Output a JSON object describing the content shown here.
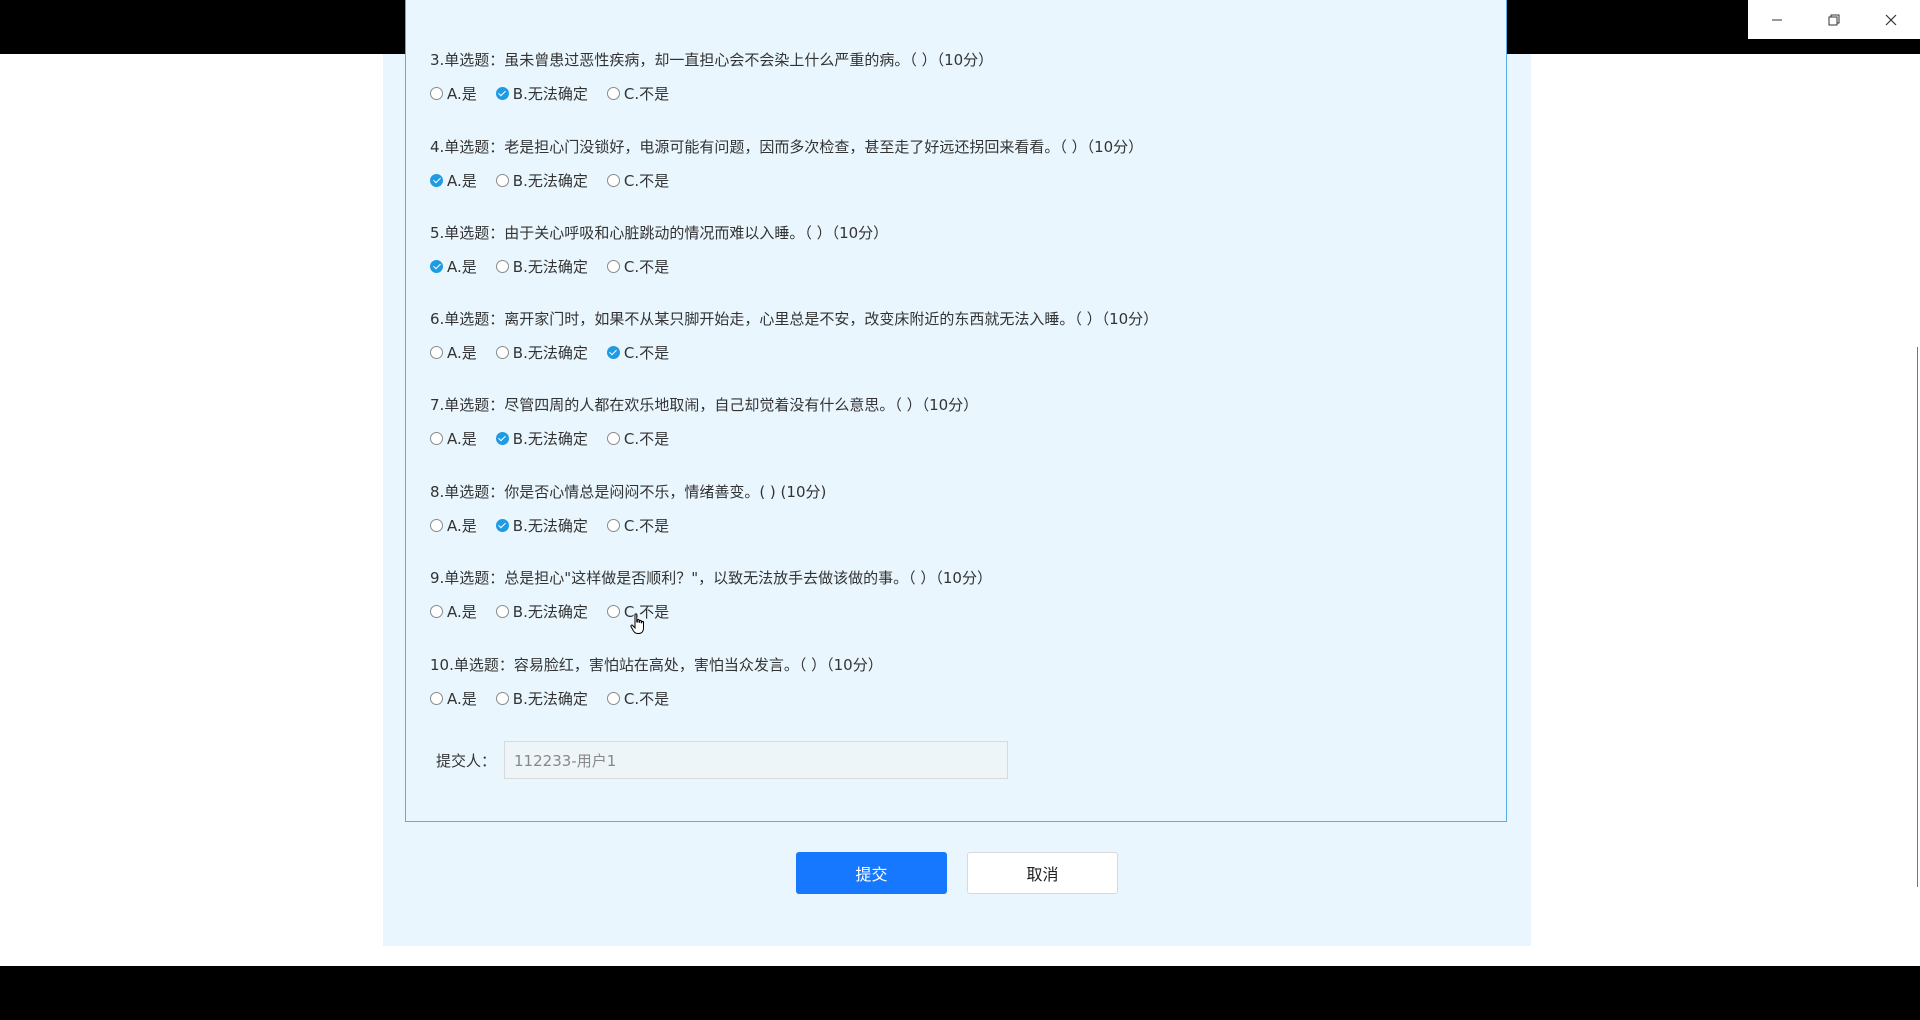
{
  "window_controls": {
    "minimize": "minimize-icon",
    "restore": "restore-icon",
    "close": "close-icon"
  },
  "questions": [
    {
      "text": "3.单选题：虽未曾患过恶性疾病，却一直担心会不会染上什么严重的病。（ ）（10分）",
      "selected": 1
    },
    {
      "text": "4.单选题：老是担心门没锁好，电源可能有问题，因而多次检查，甚至走了好远还拐回来看看。（ ）（10分）",
      "selected": 0
    },
    {
      "text": "5.单选题：由于关心呼吸和心脏跳动的情况而难以入睡。（ ）（10分）",
      "selected": 0
    },
    {
      "text": "6.单选题：离开家门时，如果不从某只脚开始走，心里总是不安，改变床附近的东西就无法入睡。（ ）（10分）",
      "selected": 2
    },
    {
      "text": "7.单选题：尽管四周的人都在欢乐地取闹，自己却觉着没有什么意思。（ ）（10分）",
      "selected": 1
    },
    {
      "text": "8.单选题：你是否心情总是闷闷不乐，情绪善变。( ) (10分)",
      "selected": 1
    },
    {
      "text": "9.单选题：总是担心\"这样做是否顺利？\"，以致无法放手去做该做的事。（ ）（10分）",
      "selected": -1
    },
    {
      "text": "10.单选题：容易脸红，害怕站在高处，害怕当众发言。（ ）（10分）",
      "selected": -1
    }
  ],
  "options": [
    "A.是",
    "B.无法确定",
    "C.不是"
  ],
  "submitter": {
    "label": "提交人：",
    "value": "112233-用户1"
  },
  "buttons": {
    "submit": "提交",
    "cancel": "取消"
  },
  "colors": {
    "accent": "#1677ff",
    "radio_checked": "#1e9be3",
    "panel_bg": "#eaf6fd",
    "form_border": "#59aee5"
  }
}
